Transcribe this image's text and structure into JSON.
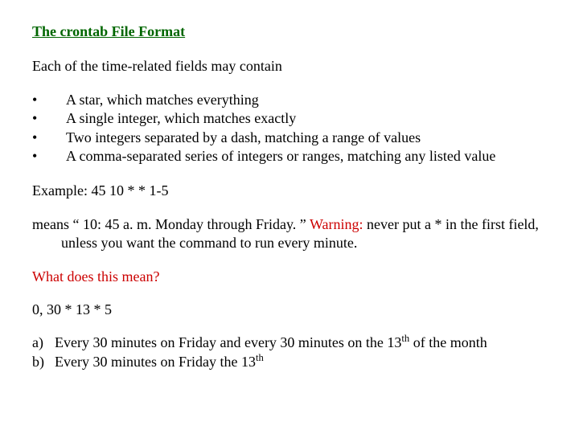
{
  "title": "The crontab File Format",
  "intro": "Each of the time-related fields may contain",
  "bullets": [
    "A star, which matches everything",
    "A single integer, which matches exactly",
    "Two integers separated by a dash, matching a range of values",
    "A comma-separated series of integers or ranges, matching any listed value"
  ],
  "example_label": "Example:  45 10 * * 1-5",
  "means_prefix": "means “ 10: 45 a. m. Monday through Friday. ”  ",
  "warning_word": "Warning:",
  "means_suffix": " never put a * in the first field, unless you want the command to run every minute.",
  "question": "What does this mean?",
  "expr": "0, 30  *  13  *  5",
  "answers": [
    {
      "label": "a)",
      "text_before": "Every 30 minutes on Friday and every 30 minutes on the 13",
      "sup": "th",
      "text_after": " of the month"
    },
    {
      "label": "b)",
      "text_before": "Every 30 minutes on Friday the 13",
      "sup": "th",
      "text_after": ""
    }
  ],
  "bullet_char": "•"
}
